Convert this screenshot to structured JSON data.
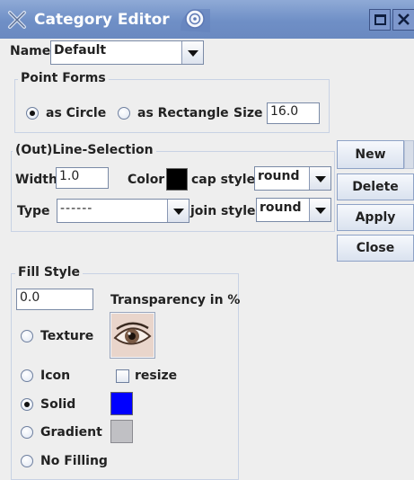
{
  "window": {
    "title": "Category Editor"
  },
  "name": {
    "label": "Name",
    "value": "Default"
  },
  "point_forms": {
    "legend": "Point Forms",
    "circle_label": "as Circle",
    "rectangle_label": "as Rectangle",
    "size_label": "Size",
    "size_value": "16.0",
    "selected": "as Circle"
  },
  "line_selection": {
    "legend": "(Out)Line-Selection",
    "width_label": "Width",
    "width_value": "1.0",
    "color_label": "Color",
    "color_value": "#000000",
    "cap_label": "cap style",
    "cap_value": "round",
    "type_label": "Type",
    "type_value": "------",
    "join_label": "join style",
    "join_value": "round"
  },
  "buttons": {
    "new": "New",
    "delete": "Delete",
    "apply": "Apply",
    "close": "Close"
  },
  "fill_style": {
    "legend": "Fill Style",
    "transparency_value": "0.0",
    "transparency_label": "Transparency in %",
    "texture_label": "Texture",
    "icon_label": "Icon",
    "resize_label": "resize",
    "solid_label": "Solid",
    "solid_color": "#0000ff",
    "gradient_label": "Gradient",
    "gradient_color": "#c0c0c4",
    "no_filling_label": "No Filling",
    "selected": "Solid"
  },
  "colors": {
    "titlebar": "#7a95c9",
    "window_bg": "#eeeeee",
    "group_border": "#c8d2e4"
  }
}
